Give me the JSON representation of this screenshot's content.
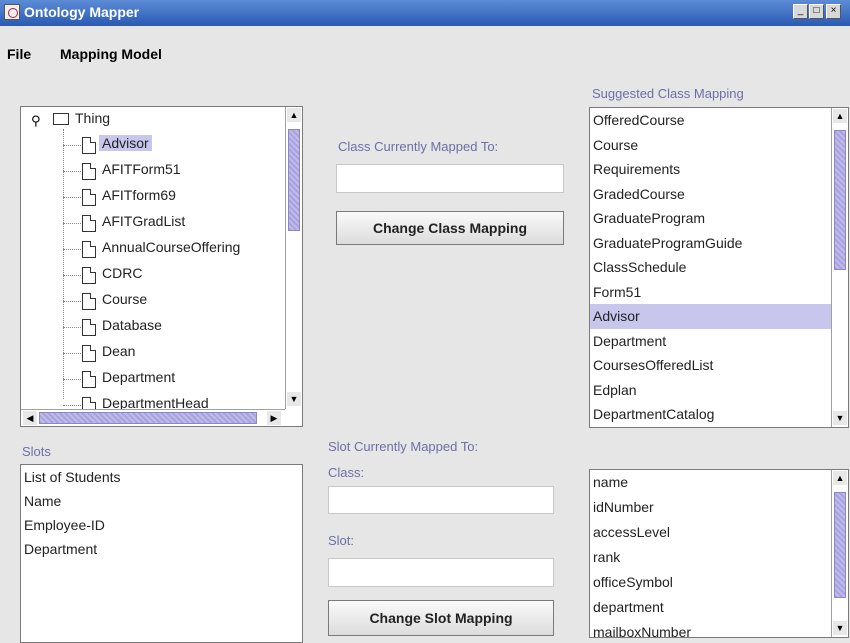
{
  "window": {
    "title": "Ontology Mapper"
  },
  "menubar": {
    "items": [
      "File",
      "Mapping Model"
    ]
  },
  "tree": {
    "root": "Thing",
    "items": [
      "Advisor",
      "AFITForm51",
      "AFITform69",
      "AFITGradList",
      "AnnualCourseOffering",
      "CDRC",
      "Course",
      "Database",
      "Dean",
      "Department",
      "DepartmentHead"
    ],
    "selected": "Advisor"
  },
  "class_mapping": {
    "label": "Class Currently Mapped To:",
    "value": "",
    "button_label": "Change Class Mapping"
  },
  "suggested": {
    "label": "Suggested Class Mapping",
    "items": [
      "OfferedCourse",
      "Course",
      "Requirements",
      "GradedCourse",
      "GraduateProgram",
      "GraduateProgramGuide",
      "ClassSchedule",
      "Form51",
      "Advisor",
      "Department",
      "CoursesOfferedList",
      "Edplan",
      "DepartmentCatalog"
    ],
    "selected": "Advisor"
  },
  "slots": {
    "label": "Slots",
    "items": [
      "List of Students",
      "Name",
      "Employee-ID",
      "Department"
    ]
  },
  "slot_mapping": {
    "label": "Slot Currently Mapped To:",
    "class_label": "Class:",
    "class_value": "",
    "slot_label": "Slot:",
    "slot_value": "",
    "button_label": "Change Slot Mapping"
  },
  "suggested_slots": {
    "items": [
      "name",
      "idNumber",
      "accessLevel",
      "rank",
      "officeSymbol",
      "department",
      "mailboxNumber"
    ]
  },
  "colors": {
    "label_text": "#6e6ea6",
    "selection": "#c8c6ec",
    "titlebar": "#2a5ab2"
  }
}
